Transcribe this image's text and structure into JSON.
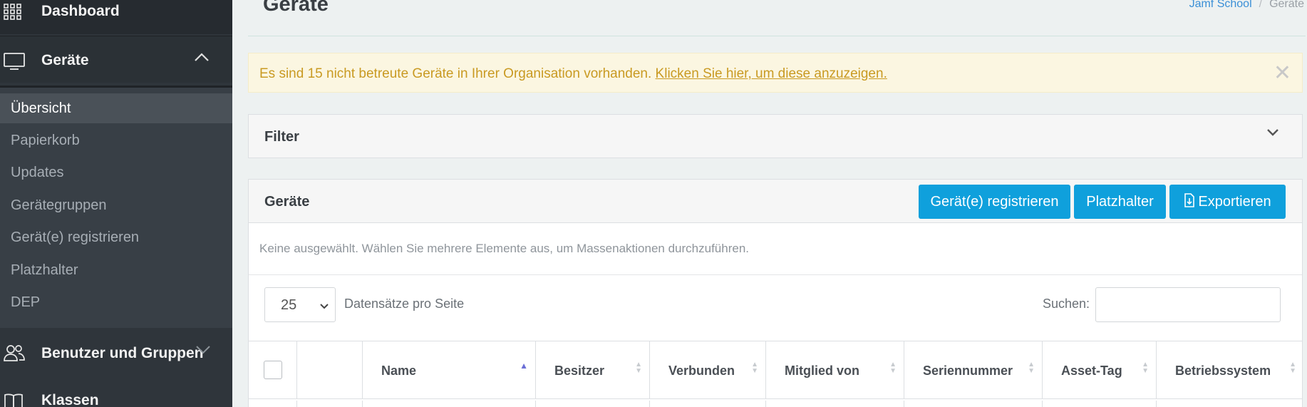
{
  "sidebar": {
    "dashboard": "Dashboard",
    "geraete": "Geräte",
    "submenu": [
      "Übersicht",
      "Papierkorb",
      "Updates",
      "Gerätegruppen",
      "Gerät(e) registrieren",
      "Platzhalter",
      "DEP"
    ],
    "benutzer": "Benutzer und Gruppen",
    "klassen": "Klassen",
    "icons": {
      "dashboard": "grid-icon",
      "geraete": "monitor-icon",
      "benutzer": "users-icon",
      "klassen": "book-icon"
    }
  },
  "header": {
    "title": "Geräte",
    "breadcrumb": {
      "home": "Jamf School",
      "current": "Geräte"
    }
  },
  "alert": {
    "text": "Es sind 15 nicht betreute Geräte in Ihrer Organisation vorhanden. ",
    "link": "Klicken Sie hier, um diese anzuzeigen.",
    "close": "✕"
  },
  "filter": {
    "title": "Filter"
  },
  "devices": {
    "title": "Geräte",
    "buttons": {
      "register": "Gerät(e) registrieren",
      "placeholder": "Platzhalter",
      "export": "Exportieren"
    },
    "hint": "Keine ausgewählt. Wählen Sie mehrere Elemente aus, um Massenaktionen durchzuführen.",
    "page_length": "25",
    "page_length_label": "Datensätze pro Seite",
    "search_label": "Suchen:",
    "search_value": "",
    "columns": [
      "Name",
      "Besitzer",
      "Verbunden",
      "Mitglied von",
      "Seriennummer",
      "Asset-Tag",
      "Betriebssystem"
    ]
  },
  "colors": {
    "accent": "#0fa0dc",
    "sidebar": "#2f353b",
    "alert_text": "#c99a22",
    "alert_bg": "#fbf6e1"
  }
}
